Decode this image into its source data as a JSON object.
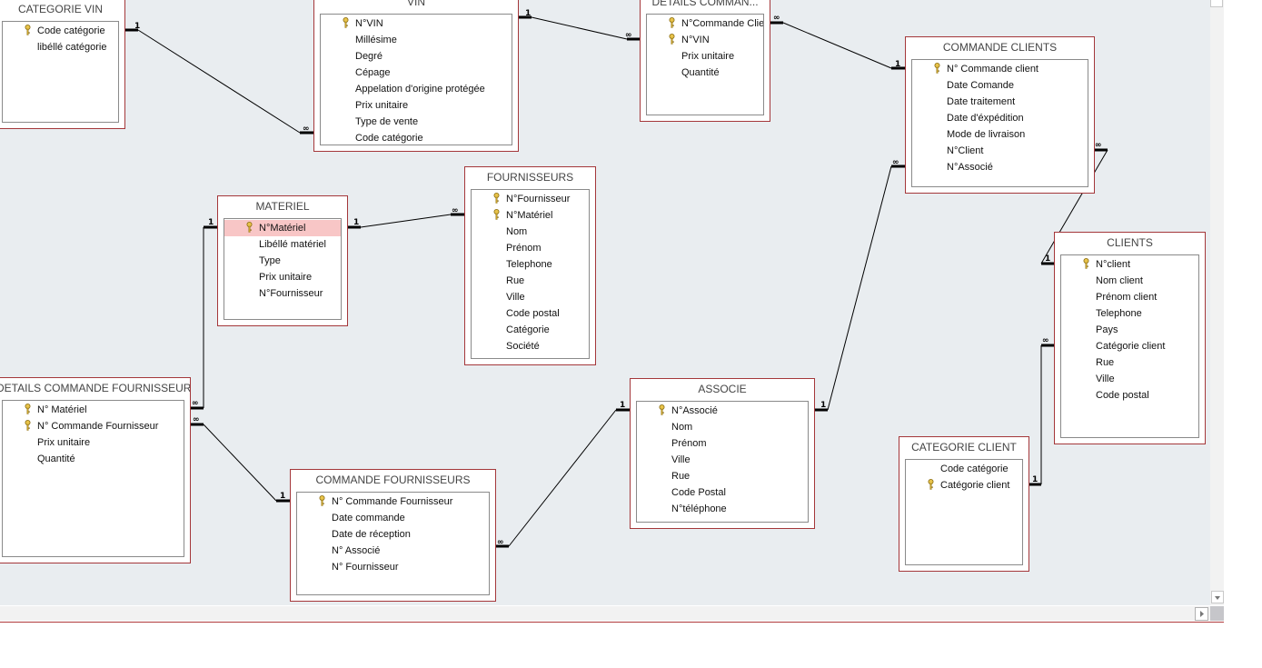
{
  "colors": {
    "canvas": "#e9edf0",
    "table_border": "#a4373a",
    "selected_row": "#f8c6c6",
    "key": "#c9a227"
  },
  "icons": {
    "primary_key": "key-icon",
    "one": "1",
    "many": "∞"
  },
  "tables": [
    {
      "id": "categorie-vin",
      "title": "CATEGORIE VIN",
      "fields": [
        {
          "name": "Code catégorie",
          "key": true
        },
        {
          "name": "libéllé catégorie",
          "key": false
        }
      ]
    },
    {
      "id": "vin",
      "title": "VIN",
      "fields": [
        {
          "name": "N°VIN",
          "key": true
        },
        {
          "name": "Millésime",
          "key": false
        },
        {
          "name": "Degré",
          "key": false
        },
        {
          "name": "Cépage",
          "key": false
        },
        {
          "name": "Appelation d'origine protégée",
          "key": false
        },
        {
          "name": "Prix unitaire",
          "key": false
        },
        {
          "name": "Type de vente",
          "key": false
        },
        {
          "name": "Code catégorie",
          "key": false
        }
      ]
    },
    {
      "id": "details-commande-clients",
      "title": "DETAILS COMMAN...",
      "fields": [
        {
          "name": "N°Commande Client",
          "key": true
        },
        {
          "name": "N°VIN",
          "key": true
        },
        {
          "name": "Prix unitaire",
          "key": false
        },
        {
          "name": "Quantité",
          "key": false
        }
      ]
    },
    {
      "id": "commande-clients",
      "title": "COMMANDE CLIENTS",
      "fields": [
        {
          "name": "N° Commande client",
          "key": true
        },
        {
          "name": "Date Comande",
          "key": false
        },
        {
          "name": "Date traitement",
          "key": false
        },
        {
          "name": "Date d'éxpédition",
          "key": false
        },
        {
          "name": "Mode de livraison",
          "key": false
        },
        {
          "name": "N°Client",
          "key": false
        },
        {
          "name": "N°Associé",
          "key": false
        }
      ]
    },
    {
      "id": "materiel",
      "title": "MATERIEL",
      "fields": [
        {
          "name": "N°Matériel",
          "key": true,
          "selected": true
        },
        {
          "name": "Libéllé matériel",
          "key": false
        },
        {
          "name": "Type",
          "key": false
        },
        {
          "name": "Prix unitaire",
          "key": false
        },
        {
          "name": "N°Fournisseur",
          "key": false
        }
      ]
    },
    {
      "id": "fournisseurs",
      "title": "FOURNISSEURS",
      "fields": [
        {
          "name": "N°Fournisseur",
          "key": true
        },
        {
          "name": "N°Matériel",
          "key": true
        },
        {
          "name": "Nom",
          "key": false
        },
        {
          "name": "Prénom",
          "key": false
        },
        {
          "name": "Telephone",
          "key": false
        },
        {
          "name": "Rue",
          "key": false
        },
        {
          "name": "Ville",
          "key": false
        },
        {
          "name": "Code postal",
          "key": false
        },
        {
          "name": "Catégorie",
          "key": false
        },
        {
          "name": "Société",
          "key": false
        }
      ]
    },
    {
      "id": "details-commande-fournisseurs",
      "title": "DETAILS COMMANDE FOURNISSEURS",
      "fields": [
        {
          "name": "N° Matériel",
          "key": true
        },
        {
          "name": "N° Commande Fournisseur",
          "key": true
        },
        {
          "name": "Prix unitaire",
          "key": false
        },
        {
          "name": "Quantité",
          "key": false
        }
      ]
    },
    {
      "id": "commande-fournisseurs",
      "title": "COMMANDE FOURNISSEURS",
      "fields": [
        {
          "name": "N° Commande Fournisseur",
          "key": true
        },
        {
          "name": "Date commande",
          "key": false
        },
        {
          "name": "Date de réception",
          "key": false
        },
        {
          "name": "N° Associé",
          "key": false
        },
        {
          "name": "N° Fournisseur",
          "key": false
        }
      ]
    },
    {
      "id": "associe",
      "title": "ASSOCIE",
      "fields": [
        {
          "name": "N°Associé",
          "key": true
        },
        {
          "name": "Nom",
          "key": false
        },
        {
          "name": "Prénom",
          "key": false
        },
        {
          "name": "Ville",
          "key": false
        },
        {
          "name": "Rue",
          "key": false
        },
        {
          "name": "Code Postal",
          "key": false
        },
        {
          "name": "N°téléphone",
          "key": false
        }
      ]
    },
    {
      "id": "categorie-client",
      "title": "CATEGORIE CLIENT",
      "fields": [
        {
          "name": "Code catégorie",
          "key": false
        },
        {
          "name": "Catégorie client",
          "key": true
        }
      ]
    },
    {
      "id": "clients",
      "title": "CLIENTS",
      "fields": [
        {
          "name": "N°client",
          "key": true
        },
        {
          "name": "Nom client",
          "key": false
        },
        {
          "name": "Prénom client",
          "key": false
        },
        {
          "name": "Telephone",
          "key": false
        },
        {
          "name": "Pays",
          "key": false
        },
        {
          "name": "Catégorie client",
          "key": false
        },
        {
          "name": "Rue",
          "key": false
        },
        {
          "name": "Ville",
          "key": false
        },
        {
          "name": "Code postal",
          "key": false
        }
      ]
    }
  ],
  "relationships": [
    {
      "from": "categorie-vin",
      "to": "vin",
      "from_card": "1",
      "to_card": "∞"
    },
    {
      "from": "vin",
      "to": "details-commande-clients",
      "from_card": "1",
      "to_card": "∞"
    },
    {
      "from": "details-commande-clients",
      "to": "commande-clients",
      "from_card": "∞",
      "to_card": "1"
    },
    {
      "from": "materiel",
      "to": "details-commande-fournisseurs",
      "from_card": "1",
      "to_card": "∞"
    },
    {
      "from": "materiel",
      "to": "fournisseurs",
      "from_card": "1",
      "to_card": "∞"
    },
    {
      "from": "details-commande-fournisseurs",
      "to": "commande-fournisseurs",
      "from_card": "∞",
      "to_card": "1"
    },
    {
      "from": "commande-fournisseurs",
      "to": "associe",
      "from_card": "∞",
      "to_card": "1"
    },
    {
      "from": "associe",
      "to": "commande-clients",
      "from_card": "1",
      "to_card": "∞"
    },
    {
      "from": "commande-clients",
      "to": "clients",
      "from_card": "∞",
      "to_card": "1"
    },
    {
      "from": "categorie-client",
      "to": "clients",
      "from_card": "1",
      "to_card": "∞"
    }
  ]
}
